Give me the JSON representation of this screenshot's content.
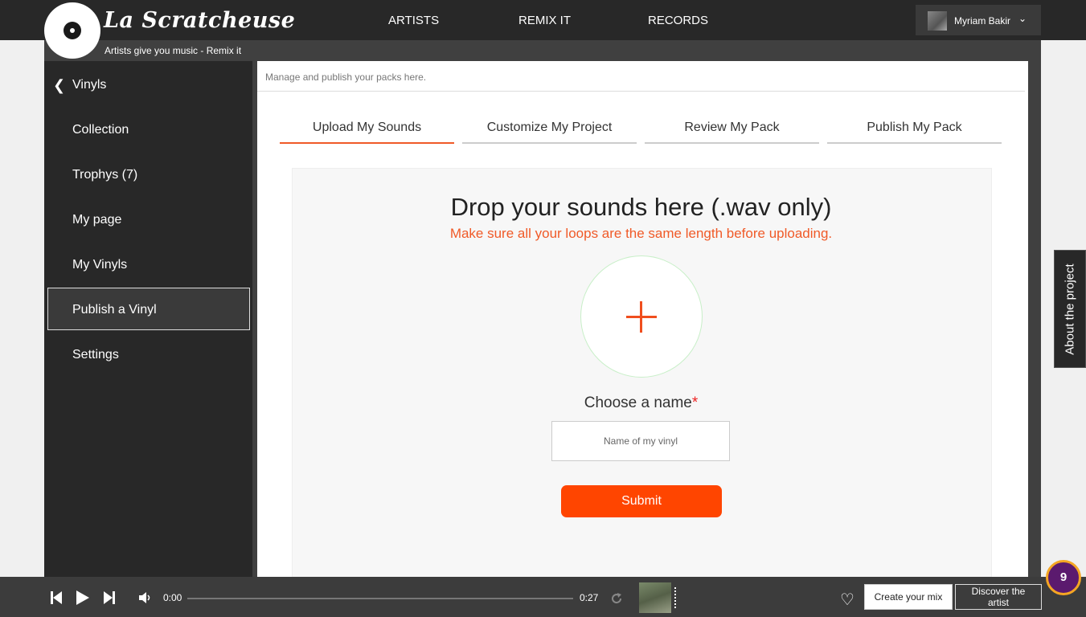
{
  "brand": {
    "name": "La Scratcheuse",
    "tagline": "Artists give you music - Remix it"
  },
  "nav": {
    "items": [
      "ARTISTS",
      "REMIX IT",
      "RECORDS"
    ]
  },
  "user": {
    "name": "Myriam Bakir"
  },
  "sidebar": {
    "back_label": "Vinyls",
    "items": [
      {
        "label": "Collection"
      },
      {
        "label": "Trophys (7)"
      },
      {
        "label": "My page"
      },
      {
        "label": "My Vinyls"
      },
      {
        "label": "Publish a Vinyl"
      },
      {
        "label": "Settings"
      }
    ],
    "active_item": "Publish a Vinyl"
  },
  "main": {
    "subtitle": "Manage and publish your packs here.",
    "tabs": [
      {
        "label": "Upload My Sounds"
      },
      {
        "label": "Customize My Project"
      },
      {
        "label": "Review My Pack"
      },
      {
        "label": "Publish My Pack"
      }
    ],
    "active_tab": "Upload My Sounds",
    "drop": {
      "title": "Drop your sounds here (.wav only)",
      "subtitle": "Make sure all your loops are the same length before uploading."
    },
    "name_label": "Choose a name",
    "required_mark": "*",
    "name_placeholder": "Name of my vinyl",
    "submit_label": "Submit"
  },
  "about_tab": {
    "label": "About the project"
  },
  "player": {
    "current_time": "0:00",
    "duration": "0:27",
    "progress": 0,
    "create_mix_label": "Create your mix",
    "discover_label": "Discover the artist",
    "notification_count": "9"
  },
  "colors": {
    "accent": "#ff4500",
    "dark": "#282828",
    "badge": "#5b1a6e"
  }
}
